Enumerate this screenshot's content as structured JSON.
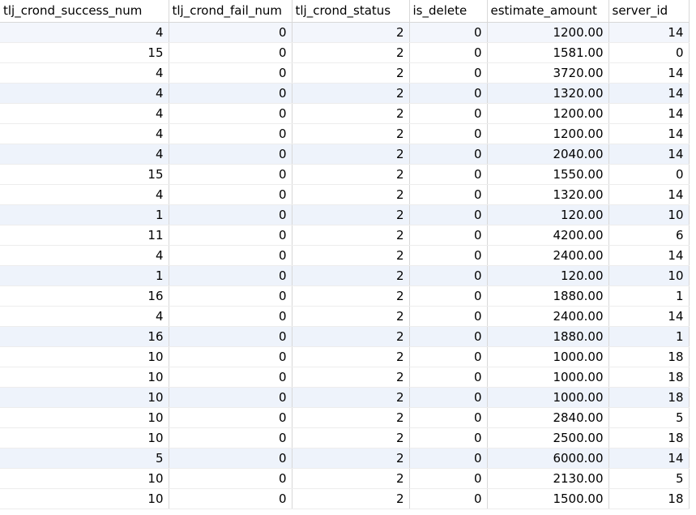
{
  "columns": [
    "tlj_crond_success_num",
    "tlj_crond_fail_num",
    "tlj_crond_status",
    "is_delete",
    "estimate_amount",
    "server_id"
  ],
  "rows": [
    [
      "4",
      "0",
      "2",
      "0",
      "1200.00",
      "14"
    ],
    [
      "15",
      "0",
      "2",
      "0",
      "1581.00",
      "0"
    ],
    [
      "4",
      "0",
      "2",
      "0",
      "3720.00",
      "14"
    ],
    [
      "4",
      "0",
      "2",
      "0",
      "1320.00",
      "14"
    ],
    [
      "4",
      "0",
      "2",
      "0",
      "1200.00",
      "14"
    ],
    [
      "4",
      "0",
      "2",
      "0",
      "1200.00",
      "14"
    ],
    [
      "4",
      "0",
      "2",
      "0",
      "2040.00",
      "14"
    ],
    [
      "15",
      "0",
      "2",
      "0",
      "1550.00",
      "0"
    ],
    [
      "4",
      "0",
      "2",
      "0",
      "1320.00",
      "14"
    ],
    [
      "1",
      "0",
      "2",
      "0",
      "120.00",
      "10"
    ],
    [
      "11",
      "0",
      "2",
      "0",
      "4200.00",
      "6"
    ],
    [
      "4",
      "0",
      "2",
      "0",
      "2400.00",
      "14"
    ],
    [
      "1",
      "0",
      "2",
      "0",
      "120.00",
      "10"
    ],
    [
      "16",
      "0",
      "2",
      "0",
      "1880.00",
      "1"
    ],
    [
      "4",
      "0",
      "2",
      "0",
      "2400.00",
      "14"
    ],
    [
      "16",
      "0",
      "2",
      "0",
      "1880.00",
      "1"
    ],
    [
      "10",
      "0",
      "2",
      "0",
      "1000.00",
      "18"
    ],
    [
      "10",
      "0",
      "2",
      "0",
      "1000.00",
      "18"
    ],
    [
      "10",
      "0",
      "2",
      "0",
      "1000.00",
      "18"
    ],
    [
      "10",
      "0",
      "2",
      "0",
      "2840.00",
      "5"
    ],
    [
      "10",
      "0",
      "2",
      "0",
      "2500.00",
      "18"
    ],
    [
      "5",
      "0",
      "2",
      "0",
      "6000.00",
      "14"
    ],
    [
      "10",
      "0",
      "2",
      "0",
      "2130.00",
      "5"
    ],
    [
      "10",
      "0",
      "2",
      "0",
      "1500.00",
      "18"
    ]
  ],
  "highlighted_rows": [
    0,
    3,
    6,
    9,
    12,
    15,
    18,
    21
  ]
}
